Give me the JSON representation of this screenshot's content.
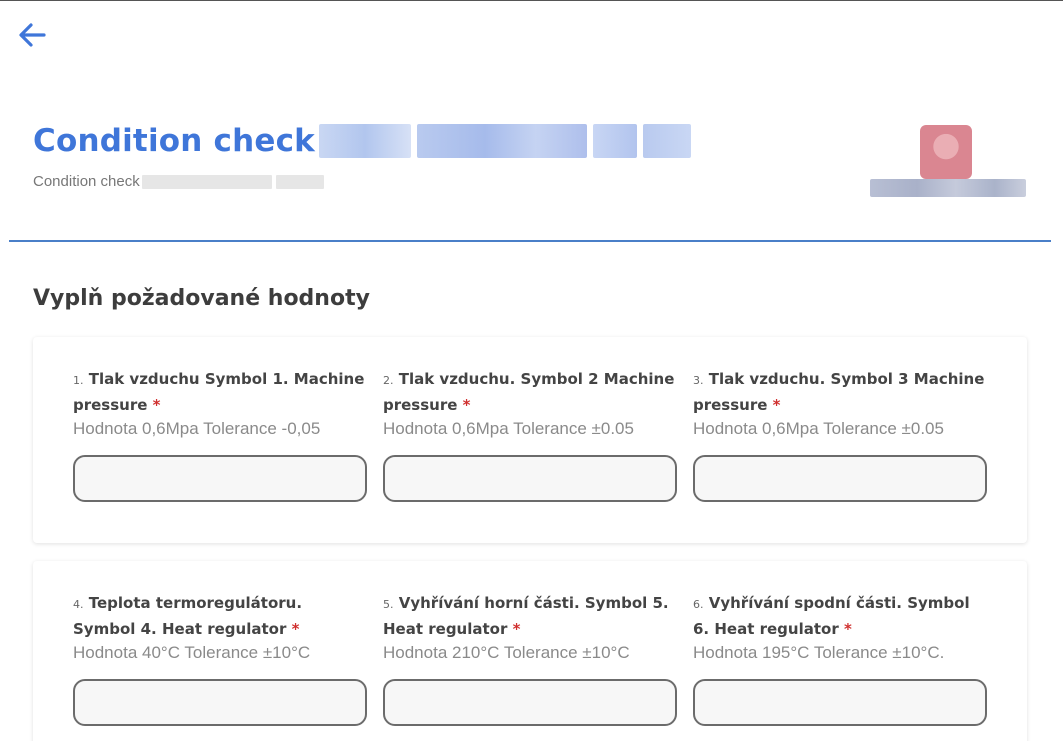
{
  "header": {
    "title": "Condition check",
    "subtitle": "Condition check"
  },
  "icons": {
    "back": "arrow-left-icon"
  },
  "colors": {
    "accent": "#3f76d9",
    "divider": "#4a7fc8",
    "required": "#d0302f"
  },
  "section": {
    "title": "Vyplň požadované hodnoty"
  },
  "fields": [
    {
      "num": "1.",
      "label": "Tlak vzduchu Symbol 1. Machine pressure",
      "required": "*",
      "hint": "Hodnota 0,6Mpa Tolerance -0,05",
      "value": ""
    },
    {
      "num": "2.",
      "label": "Tlak vzduchu. Symbol 2 Machine pressure",
      "required": "*",
      "hint": "Hodnota 0,6Mpa Tolerance ±0.05",
      "value": ""
    },
    {
      "num": "3.",
      "label": "Tlak vzduchu. Symbol 3 Machine pressure",
      "required": "*",
      "hint": "Hodnota 0,6Mpa Tolerance ±0.05",
      "value": ""
    },
    {
      "num": "4.",
      "label": "Teplota termoregulátoru. Symbol 4. Heat regulator",
      "required": "*",
      "hint": "Hodnota 40°C Tolerance ±10°C",
      "value": ""
    },
    {
      "num": "5.",
      "label": "Vyhřívání horní části. Symbol 5. Heat regulator",
      "required": "*",
      "hint": "Hodnota 210°C Tolerance ±10°C",
      "value": ""
    },
    {
      "num": "6.",
      "label": "Vyhřívání spodní části. Symbol 6. Heat regulator",
      "required": "*",
      "hint": "Hodnota 195°C Tolerance ±10°C.",
      "value": ""
    }
  ]
}
